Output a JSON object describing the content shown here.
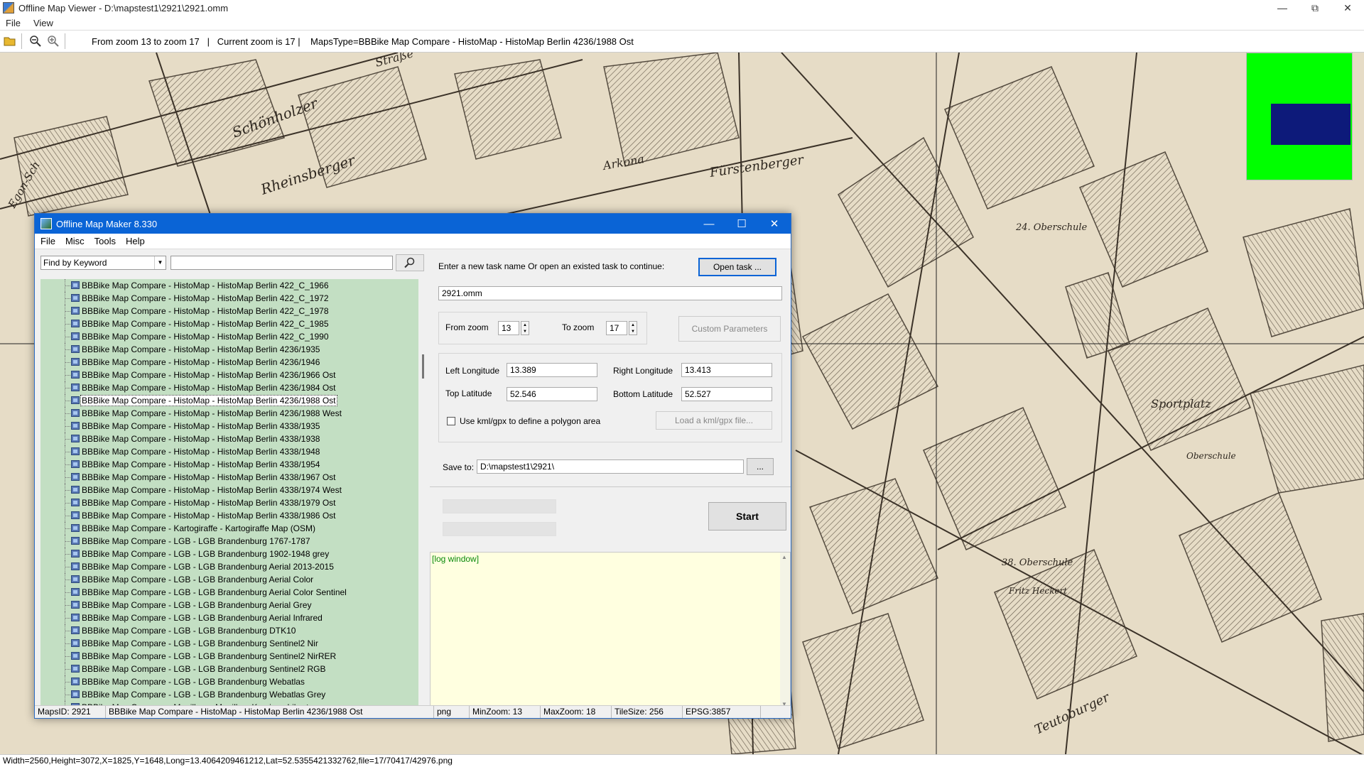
{
  "viewer": {
    "title": "Offline Map Viewer - D:\\mapstest1\\2921\\2921.omm",
    "menu": [
      "File",
      "View"
    ],
    "zoom_info": "From zoom 13 to zoom 17   |   Current zoom is 17 |    MapsType=BBBike Map Compare - HistoMap - HistoMap Berlin 4236/1988 Ost",
    "status": "Width=2560,Height=3072,X=1825,Y=1648,Long=13.4064209461212,Lat=52.5355421332762,file=17/70417/42976.png",
    "minimap_colors": {
      "background": "#00ff00",
      "viewport": "#0d1a7a"
    }
  },
  "map_labels": [
    "Schönholzer",
    "Rheinsberger",
    "Straße",
    "Arkona",
    "Fürstenberger",
    "24. Oberschule",
    "Sportplatz",
    "38. Oberschule",
    "Fritz Heckert",
    "Teutoburger",
    "Oberschule",
    "Egon-Sch"
  ],
  "dialog": {
    "title": "Offline Map Maker 8.330",
    "menu": [
      "File",
      "Misc",
      "Tools",
      "Help"
    ],
    "find_mode": "Find by Keyword",
    "search_value": "",
    "tree_items": [
      "BBBike Map Compare - HistoMap - HistoMap Berlin 422_C_1966",
      "BBBike Map Compare - HistoMap - HistoMap Berlin 422_C_1972",
      "BBBike Map Compare - HistoMap - HistoMap Berlin 422_C_1978",
      "BBBike Map Compare - HistoMap - HistoMap Berlin 422_C_1985",
      "BBBike Map Compare - HistoMap - HistoMap Berlin 422_C_1990",
      "BBBike Map Compare - HistoMap - HistoMap Berlin 4236/1935",
      "BBBike Map Compare - HistoMap - HistoMap Berlin 4236/1946",
      "BBBike Map Compare - HistoMap - HistoMap Berlin 4236/1966 Ost",
      "BBBike Map Compare - HistoMap - HistoMap Berlin 4236/1984 Ost",
      "BBBike Map Compare - HistoMap - HistoMap Berlin 4236/1988 Ost",
      "BBBike Map Compare - HistoMap - HistoMap Berlin 4236/1988 West",
      "BBBike Map Compare - HistoMap - HistoMap Berlin 4338/1935",
      "BBBike Map Compare - HistoMap - HistoMap Berlin 4338/1938",
      "BBBike Map Compare - HistoMap - HistoMap Berlin 4338/1948",
      "BBBike Map Compare - HistoMap - HistoMap Berlin 4338/1954",
      "BBBike Map Compare - HistoMap - HistoMap Berlin 4338/1967 Ost",
      "BBBike Map Compare - HistoMap - HistoMap Berlin 4338/1974 West",
      "BBBike Map Compare - HistoMap - HistoMap Berlin 4338/1979 Ost",
      "BBBike Map Compare - HistoMap - HistoMap Berlin 4338/1986 Ost",
      "BBBike Map Compare - Kartogiraffe - Kartogiraffe Map (OSM)",
      "BBBike Map Compare - LGB - LGB Brandenburg 1767-1787",
      "BBBike Map Compare - LGB - LGB Brandenburg 1902-1948 grey",
      "BBBike Map Compare - LGB - LGB Brandenburg Aerial 2013-2015",
      "BBBike Map Compare - LGB - LGB Brandenburg Aerial Color",
      "BBBike Map Compare - LGB - LGB Brandenburg Aerial Color Sentinel",
      "BBBike Map Compare - LGB - LGB Brandenburg Aerial Grey",
      "BBBike Map Compare - LGB - LGB Brandenburg Aerial Infrared",
      "BBBike Map Compare - LGB - LGB Brandenburg DTK10",
      "BBBike Map Compare - LGB - LGB Brandenburg Sentinel2 Nir",
      "BBBike Map Compare - LGB - LGB Brandenburg Sentinel2 NirRER",
      "BBBike Map Compare - LGB - LGB Brandenburg Sentinel2 RGB",
      "BBBike Map Compare - LGB - LGB Brandenburg Webatlas",
      "BBBike Map Compare - LGB - LGB Brandenburg Webatlas Grey",
      "BBBike Map Compare - Mapillary - Mapillary Kurvison Liberty"
    ],
    "selected_index": 9,
    "task_prompt": "Enter a new task name Or open an existed task to continue:",
    "open_task_label": "Open task ...",
    "task_name": "2921.omm",
    "from_zoom_label": "From zoom",
    "from_zoom": "13",
    "to_zoom_label": "To zoom",
    "to_zoom": "17",
    "custom_params_label": "Custom Parameters",
    "left_lon_label": "Left Longitude",
    "left_lon": "13.389",
    "right_lon_label": "Right Longitude",
    "right_lon": "13.413",
    "top_lat_label": "Top Latitude",
    "top_lat": "52.546",
    "bottom_lat_label": "Bottom Latitude",
    "bottom_lat": "52.527",
    "kml_checkbox_label": "Use kml/gpx to define a polygon area",
    "load_kml_label": "Load a kml/gpx file...",
    "save_to_label": "Save to:",
    "save_to": "D:\\mapstest1\\2921\\",
    "browse_label": "...",
    "start_label": "Start",
    "log_label": "[log window]",
    "status": {
      "maps_id": "MapsID: 2921",
      "map_name": "BBBike Map Compare - HistoMap - HistoMap Berlin 4236/1988 Ost",
      "format": "png",
      "min_zoom": "MinZoom: 13",
      "max_zoom": "MaxZoom: 18",
      "tile_size": "TileSize: 256",
      "epsg": "EPSG:3857"
    }
  }
}
